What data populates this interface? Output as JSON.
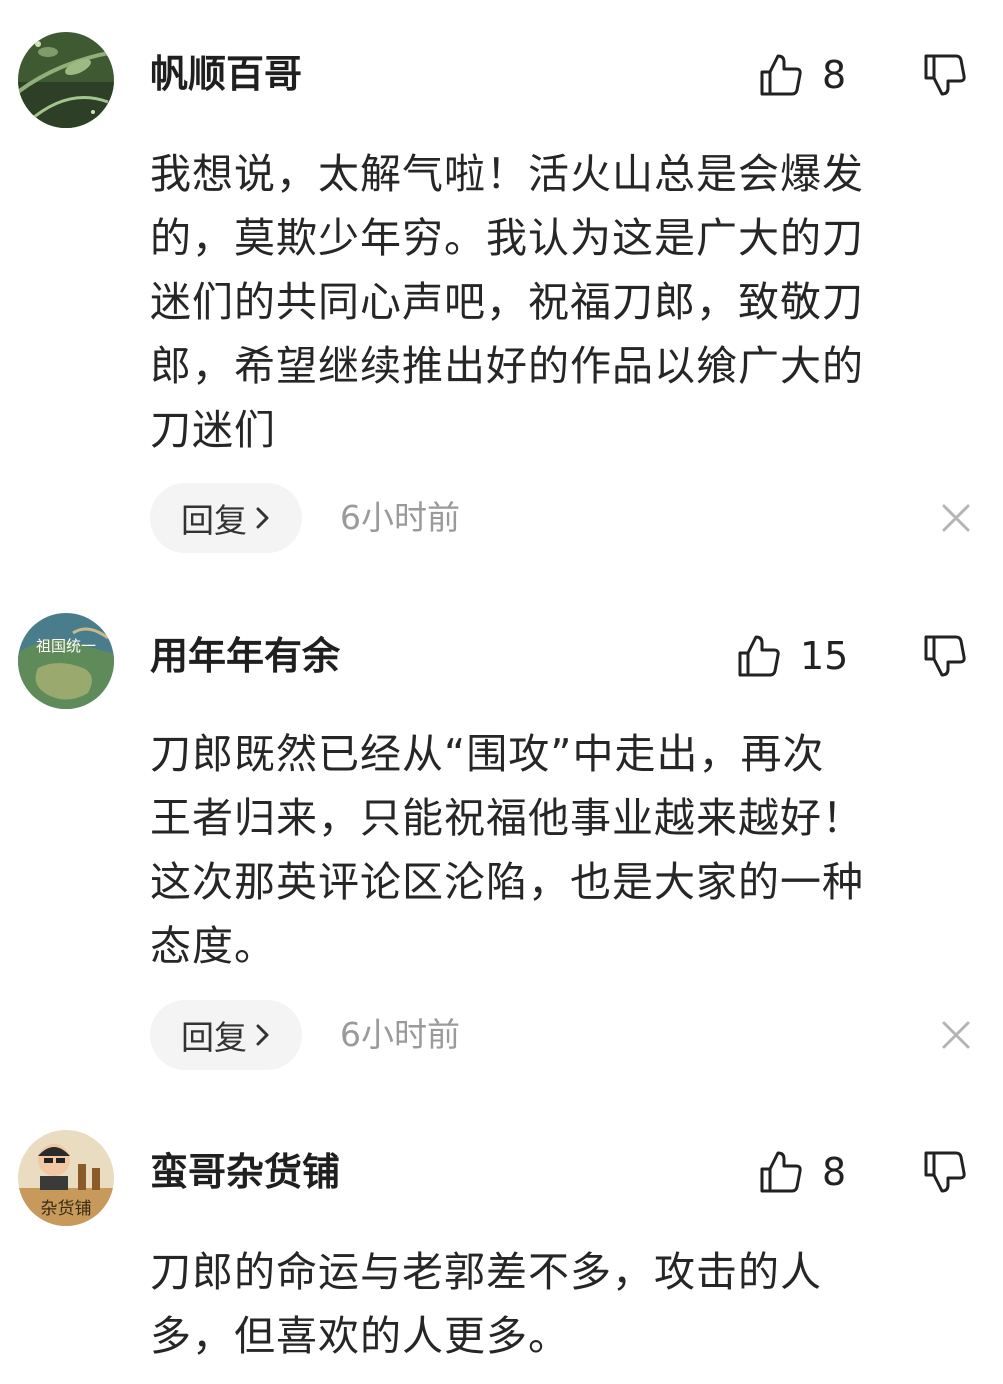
{
  "comments": [
    {
      "username": "帆顺百哥",
      "likes": "8",
      "text": "我想说，太解气啦！活火山总是会爆发\n的，莫欺少年穷。我认为这是广大的刀\n迷们的共同心声吧，祝福刀郎，致敬刀\n郎，希望继续推出好的作品以飨广大的\n刀迷们",
      "reply_label": "回复",
      "time": "6小时前",
      "avatar_icon": "plant-avatar-icon"
    },
    {
      "username": "用年年有余",
      "likes": "15",
      "text": "刀郎既然已经从“围攻”中走出，再次\n王者归来，只能祝福他事业越来越好！\n这次那英评论区沦陷，也是大家的一种\n态度。",
      "reply_label": "回复",
      "time": "6小时前",
      "avatar_icon": "map-avatar-icon",
      "avatar_text": "祖国统一"
    },
    {
      "username": "蛮哥杂货铺",
      "likes": "8",
      "text": "刀郎的命运与老郭差不多，攻击的人\n多，但喜欢的人更多。",
      "avatar_icon": "shop-avatar-icon",
      "avatar_text": "杂货铺"
    }
  ],
  "icons": {
    "like": "thumbs-up-icon",
    "dislike": "thumbs-down-icon",
    "close": "close-icon",
    "chevron": "chevron-right-icon"
  }
}
